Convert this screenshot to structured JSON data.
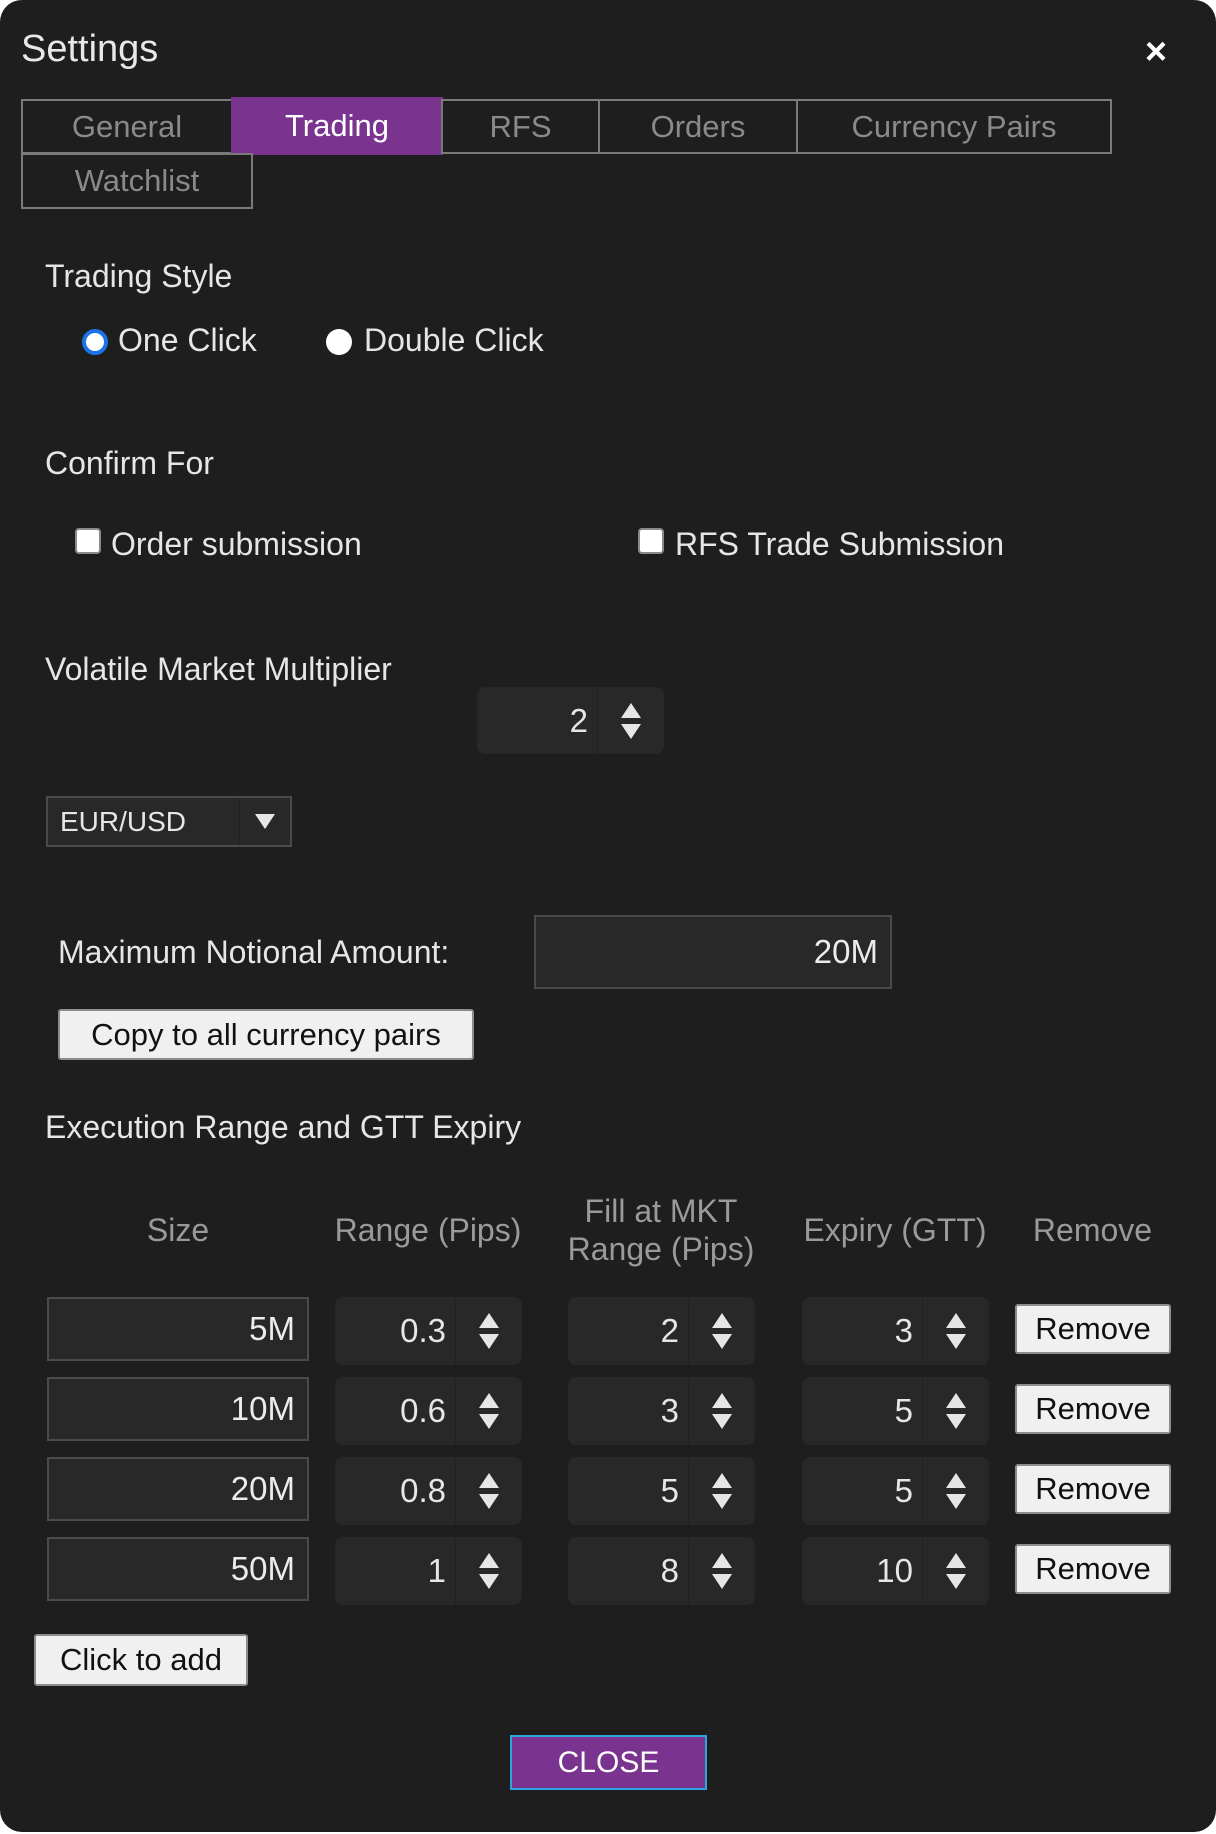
{
  "dialog": {
    "title": "Settings",
    "close_icon": "×"
  },
  "tabs": [
    {
      "label": "General",
      "active": false
    },
    {
      "label": "Trading",
      "active": true
    },
    {
      "label": "RFS",
      "active": false
    },
    {
      "label": "Orders",
      "active": false
    },
    {
      "label": "Currency Pairs",
      "active": false
    },
    {
      "label": "Watchlist",
      "active": false
    }
  ],
  "trading_style": {
    "heading": "Trading Style",
    "options": [
      {
        "label": "One Click",
        "selected": true
      },
      {
        "label": "Double Click",
        "selected": false
      }
    ]
  },
  "confirm_for": {
    "heading": "Confirm For",
    "options": [
      {
        "label": "Order submission",
        "checked": false
      },
      {
        "label": "RFS Trade Submission",
        "checked": false
      }
    ]
  },
  "volatile_market_multiplier": {
    "label": "Volatile Market Multiplier",
    "value": "2"
  },
  "currency_pair_select": {
    "selected": "EUR/USD"
  },
  "max_notional": {
    "label": "Maximum Notional Amount:",
    "value": "20M",
    "copy_button": "Copy to all currency pairs"
  },
  "execution": {
    "heading": "Execution Range and GTT Expiry",
    "columns": {
      "size": "Size",
      "range": "Range (Pips)",
      "fill_line1": "Fill at MKT",
      "fill_line2": "Range (Pips)",
      "expiry": "Expiry (GTT)",
      "remove": "Remove"
    },
    "rows": [
      {
        "size": "5M",
        "range": "0.3",
        "fill": "2",
        "expiry": "3",
        "remove": "Remove"
      },
      {
        "size": "10M",
        "range": "0.6",
        "fill": "3",
        "expiry": "5",
        "remove": "Remove"
      },
      {
        "size": "20M",
        "range": "0.8",
        "fill": "5",
        "expiry": "5",
        "remove": "Remove"
      },
      {
        "size": "50M",
        "range": "1",
        "fill": "8",
        "expiry": "10",
        "remove": "Remove"
      }
    ],
    "add_button": "Click to add"
  },
  "footer": {
    "close_button": "CLOSE"
  },
  "colors": {
    "accent": "#7a338f",
    "background": "#1e1e1e",
    "radio_selected": "#1a73e8"
  }
}
